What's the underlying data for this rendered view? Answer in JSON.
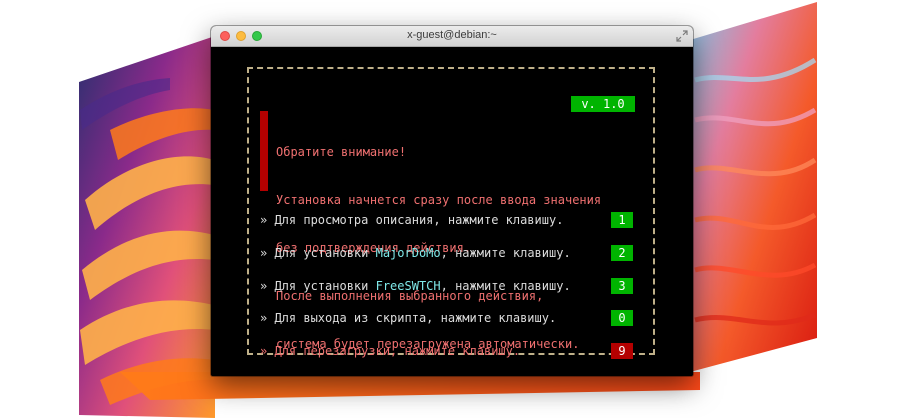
{
  "window": {
    "title": "x-guest@debian:~"
  },
  "installer": {
    "version": "v. 1.0",
    "warning": [
      "Обратите внимание!",
      "Установка начнется сразу после ввода значения",
      "без подтверждения действия.",
      "После выполнения выбранного действия,",
      "система будет перезагружена автоматически."
    ],
    "options": [
      {
        "prefix": "» Для просмотра описания, нажмите клавишу.",
        "highlight": "",
        "suffix": "",
        "key": "1"
      },
      {
        "prefix": "» Для установки ",
        "highlight": "MajorDoMo",
        "suffix": ", нажмите клавишу.",
        "key": "2"
      },
      {
        "prefix": "» Для установки ",
        "highlight": "FreeSWTCH",
        "suffix": ", нажмите клавишу.",
        "key": "3"
      },
      {
        "prefix": "» Для выхода из скрипта, нажмите клавишу.",
        "highlight": "",
        "suffix": "",
        "key": "0"
      },
      {
        "prefix": "» Для перезагрузки, нажмите клавишу.",
        "highlight": "",
        "suffix": "",
        "key": "9"
      }
    ]
  },
  "colors": {
    "key_green": "#00b400",
    "key_red": "#b40000",
    "warning_text": "#ef7070",
    "highlight_text": "#7fe8e8",
    "frame_border": "#bfb089"
  },
  "icons": {
    "close": "close-icon",
    "minimize": "minimize-icon",
    "maximize": "maximize-icon",
    "fullscreen": "fullscreen-icon"
  }
}
